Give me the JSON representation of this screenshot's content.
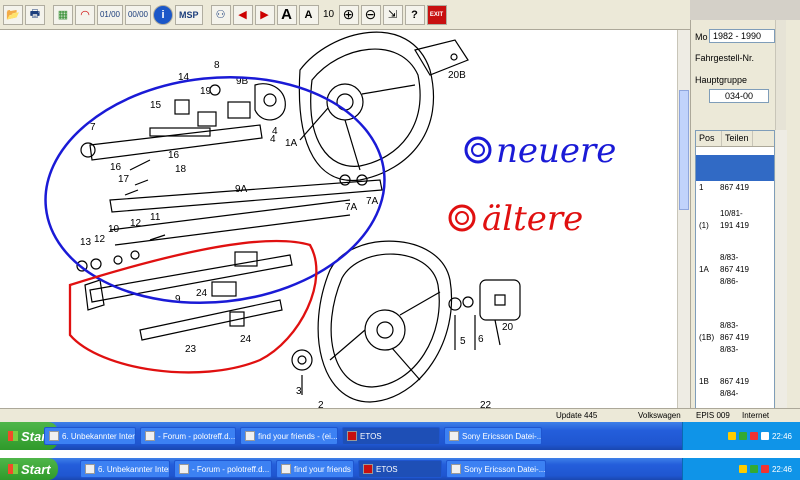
{
  "toolbar": {
    "buttons": [
      {
        "name": "open-folder-icon",
        "glyph": "📂"
      },
      {
        "name": "print-icon",
        "glyph": "🖶"
      },
      {
        "name": "grid-icon",
        "glyph": "▦"
      },
      {
        "name": "gauge-icon",
        "glyph": "◠"
      }
    ],
    "page_value_1": "01/00",
    "page_value_2": "00/00",
    "info_glyph": "i",
    "msp_label": "MSP",
    "binoculars_glyph": "⚇",
    "prev_glyph": "◀",
    "next_glyph": "▶",
    "font_large_glyph": "A",
    "font_small_glyph": "A",
    "zoom_value": "10",
    "zoom_in_glyph": "⊕",
    "zoom_out_glyph": "⊖",
    "help_glyph": "?",
    "exit_label": "EXIT"
  },
  "drawing": {
    "callouts": [
      "14",
      "8",
      "9B",
      "19",
      "15",
      "4",
      "7",
      "16",
      "16",
      "17",
      "18",
      "1A",
      "9A",
      "7A",
      "7A",
      "13",
      "12",
      "10",
      "12",
      "11",
      "20B",
      "9",
      "24",
      "24",
      "23",
      "5",
      "6",
      "20",
      "3",
      "2",
      "22",
      "4"
    ],
    "annotation_new": "neuere",
    "annotation_old": "ältere",
    "new_color": "#1a1ad6",
    "old_color": "#e01010"
  },
  "right_panel": {
    "model_label": "Mo",
    "year_range": "1982 - 1990",
    "chassis_label": "Fahrgestell-Nr.",
    "main_group_label": "Hauptgruppe",
    "main_group_value": "034-00",
    "parts_header": {
      "pos": "Pos",
      "part": "Teilen"
    },
    "parts": [
      {
        "pos": "1",
        "num": "867 419"
      },
      {
        "pos": "",
        "num": "10/81-"
      },
      {
        "pos": "(1)",
        "num": "191 419"
      },
      {
        "pos": "",
        "num": "8/83-"
      },
      {
        "pos": "1A",
        "num": "867 419"
      },
      {
        "pos": "",
        "num": "8/86-"
      },
      {
        "pos": "",
        "num": "8/83-"
      },
      {
        "pos": "(1B)",
        "num": "867 419"
      },
      {
        "pos": "",
        "num": "8/83-"
      },
      {
        "pos": "1B",
        "num": "867 419"
      },
      {
        "pos": "",
        "num": "8/84-"
      }
    ]
  },
  "statusbar": {
    "update": "Update 445",
    "brand": "Volkswagen",
    "epis": "EPIS 009",
    "internet": "Internet"
  },
  "taskbar": {
    "start_label": "Start",
    "tasks": [
      "6. Unbekannter Inter...",
      "- Forum - polotreff.d...",
      "find your friends - (ei...",
      "ETOS",
      "Sony Ericsson Datei-..."
    ],
    "clock": "22:46"
  },
  "taskbar2": {
    "start_label": "Start",
    "tasks": [
      "6. Unbekannter Inter...",
      "- Forum - polotreff.d...",
      "find your friends - (ei...",
      "ETOS",
      "Sony Ericsson Datei-..."
    ],
    "clock": "22:46"
  }
}
